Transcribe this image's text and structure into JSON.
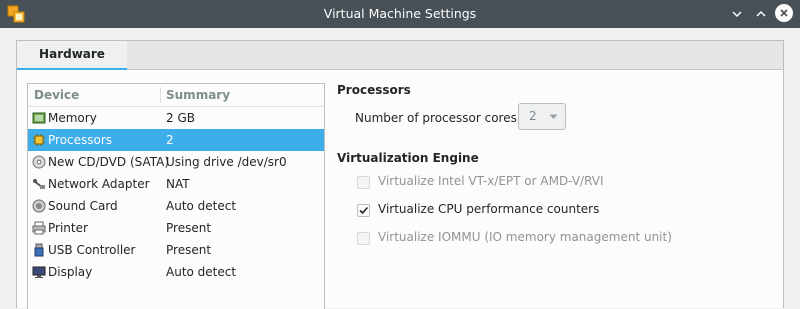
{
  "window": {
    "title": "Virtual Machine Settings"
  },
  "tabs": [
    {
      "label": "Hardware"
    }
  ],
  "device_list": {
    "headers": {
      "device": "Device",
      "summary": "Summary"
    },
    "rows": [
      {
        "name": "Memory",
        "summary": "2 GB",
        "icon": "memory-icon"
      },
      {
        "name": "Processors",
        "summary": "2",
        "icon": "processor-icon",
        "selected": true
      },
      {
        "name": "New CD/DVD (SATA)",
        "summary": "Using drive /dev/sr0",
        "icon": "cd-dvd-icon"
      },
      {
        "name": "Network Adapter",
        "summary": "NAT",
        "icon": "network-adapter-icon"
      },
      {
        "name": "Sound Card",
        "summary": "Auto detect",
        "icon": "sound-card-icon"
      },
      {
        "name": "Printer",
        "summary": "Present",
        "icon": "printer-icon"
      },
      {
        "name": "USB Controller",
        "summary": "Present",
        "icon": "usb-icon"
      },
      {
        "name": "Display",
        "summary": "Auto detect",
        "icon": "display-icon"
      }
    ]
  },
  "processors": {
    "title": "Processors",
    "cores_label": "Number of processor cores:",
    "cores_value": "2"
  },
  "virtualization": {
    "title": "Virtualization Engine",
    "options": [
      {
        "label": "Virtualize Intel VT-x/EPT or AMD-V/RVI",
        "checked": false,
        "enabled": false
      },
      {
        "label": "Virtualize CPU performance counters",
        "checked": true,
        "enabled": true
      },
      {
        "label": "Virtualize IOMMU (IO memory management unit)",
        "checked": false,
        "enabled": false
      }
    ]
  },
  "colors": {
    "accent": "#3daee9",
    "titlebar": "#475057"
  }
}
